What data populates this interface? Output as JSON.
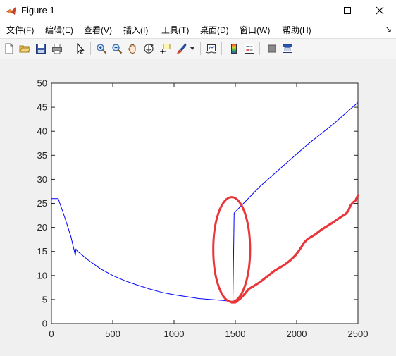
{
  "window": {
    "title": "Figure 1",
    "controls": [
      "minimize",
      "maximize",
      "close"
    ]
  },
  "menu": {
    "items": [
      "文件(F)",
      "编辑(E)",
      "查看(V)",
      "插入(I)",
      "工具(T)",
      "桌面(D)",
      "窗口(W)",
      "帮助(H)"
    ]
  },
  "toolbar": {
    "icons": [
      "new-figure-icon",
      "open-icon",
      "save-icon",
      "print-icon",
      "pointer-icon",
      "zoom-in-icon",
      "zoom-out-icon",
      "pan-icon",
      "rotate-3d-icon",
      "data-cursor-icon",
      "brush-icon",
      "link-plot-icon",
      "colorbar-icon",
      "legend-icon",
      "hide-plot-tools-icon",
      "show-plot-tools-icon"
    ]
  },
  "chart_data": {
    "type": "line",
    "title": "",
    "xlabel": "",
    "ylabel": "",
    "xlim": [
      0,
      2500
    ],
    "ylim": [
      0,
      50
    ],
    "xticks": [
      0,
      500,
      1000,
      1500,
      2000,
      2500
    ],
    "yticks": [
      0,
      5,
      10,
      15,
      20,
      25,
      30,
      35,
      40,
      45,
      50
    ],
    "grid": false,
    "series": [
      {
        "color": "#0000ff",
        "points": [
          [
            0,
            26
          ],
          [
            55,
            26
          ],
          [
            110,
            22
          ],
          [
            160,
            18
          ],
          [
            195,
            14.2
          ],
          [
            200,
            15.5
          ],
          [
            210,
            15.1
          ],
          [
            300,
            13.2
          ],
          [
            400,
            11.4
          ],
          [
            500,
            10.0
          ],
          [
            600,
            8.9
          ],
          [
            700,
            8.0
          ],
          [
            800,
            7.2
          ],
          [
            900,
            6.5
          ],
          [
            1000,
            6.0
          ],
          [
            1100,
            5.6
          ],
          [
            1200,
            5.2
          ],
          [
            1300,
            5.0
          ],
          [
            1400,
            4.8
          ],
          [
            1480,
            4.6
          ],
          [
            1490,
            23
          ],
          [
            1700,
            28.5
          ],
          [
            1900,
            33
          ],
          [
            2100,
            37.5
          ],
          [
            2300,
            41.5
          ],
          [
            2500,
            46
          ]
        ]
      },
      {
        "color": "#e8363a",
        "points": [
          [
            1470,
            4.4
          ],
          [
            1500,
            4.4
          ],
          [
            1540,
            5.2
          ],
          [
            1570,
            6.0
          ],
          [
            1590,
            6.6
          ],
          [
            1610,
            7.2
          ],
          [
            1650,
            7.8
          ],
          [
            1700,
            8.6
          ],
          [
            1740,
            9.4
          ],
          [
            1780,
            10.2
          ],
          [
            1820,
            11.0
          ],
          [
            1860,
            11.6
          ],
          [
            1900,
            12.2
          ],
          [
            1950,
            13.2
          ],
          [
            1990,
            14.2
          ],
          [
            2020,
            15.2
          ],
          [
            2040,
            16.0
          ],
          [
            2060,
            16.8
          ],
          [
            2090,
            17.6
          ],
          [
            2150,
            18.5
          ],
          [
            2200,
            19.5
          ],
          [
            2250,
            20.3
          ],
          [
            2300,
            21.1
          ],
          [
            2350,
            22.0
          ],
          [
            2400,
            22.8
          ],
          [
            2420,
            23.4
          ],
          [
            2440,
            24.6
          ],
          [
            2460,
            25.2
          ],
          [
            2480,
            25.6
          ],
          [
            2500,
            26.7
          ]
        ]
      }
    ],
    "annotations": [
      {
        "type": "ellipse",
        "color": "#e8363a",
        "center": [
          1470,
          15.4
        ],
        "rx": 150,
        "ry": 10.9
      }
    ]
  }
}
